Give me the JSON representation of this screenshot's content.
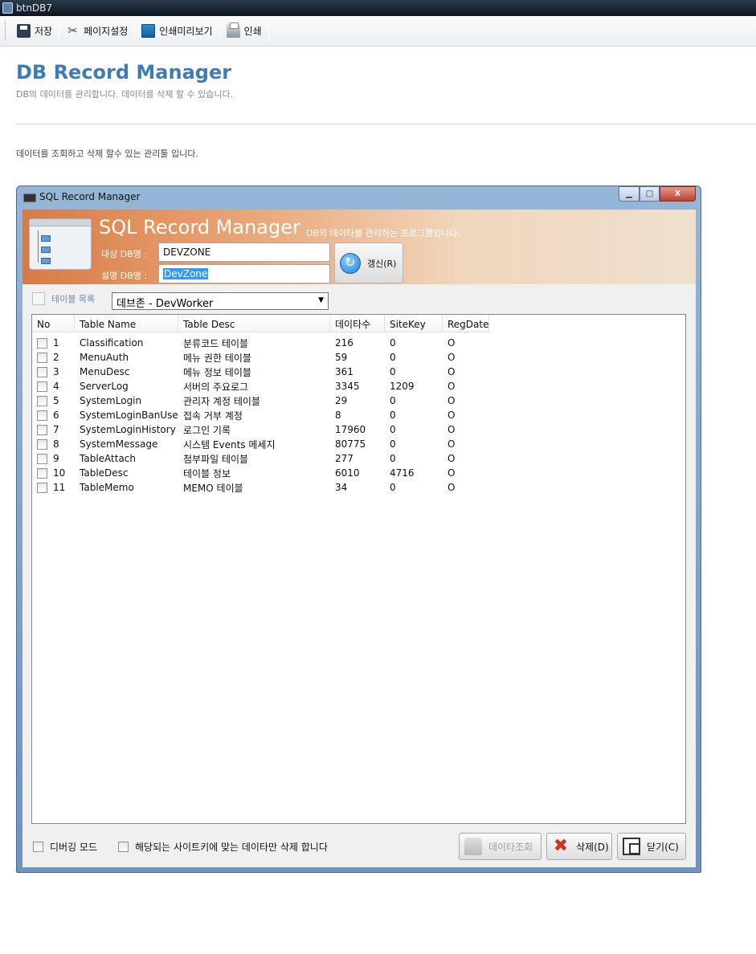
{
  "app_title": "btnDB7",
  "toolbar": {
    "save": "저장",
    "page_setup": "페이지설정",
    "print_preview": "인쇄미리보기",
    "print": "인쇄"
  },
  "page": {
    "title": "DB Record Manager",
    "subtitle": "DB의 데이터를 관리합니다. 데이터를 삭제 할 수 있습니다.",
    "description": "데이터를 조회하고 삭제 할수 있는 관리툴 입니다."
  },
  "window": {
    "title": "SQL Record Manager",
    "controls": {
      "min": "▁",
      "max": "□",
      "close": "X"
    }
  },
  "banner": {
    "title": "SQL Record Manager",
    "subtitle": "DB의 데이타를 관리하는 프로그램입니다.",
    "target_db_label": "대상 DB명 :",
    "target_db_value": "DEVZONE",
    "desc_db_label": "설명 DB명 :",
    "desc_db_value": "DevZone",
    "refresh_button": "갱신(R)"
  },
  "table_selector": {
    "label": "테이블 목록",
    "selected": "데브존 - DevWorker"
  },
  "grid": {
    "columns": [
      "No",
      "Table Name",
      "Table Desc",
      "데이타수",
      "SiteKey",
      "RegDate"
    ],
    "rows": [
      {
        "no": "1",
        "name": "Classification",
        "desc": "분류코드 테이블",
        "count": "216",
        "sitekey": "0",
        "regdate": "O"
      },
      {
        "no": "2",
        "name": "MenuAuth",
        "desc": "메뉴 권한 테이블",
        "count": "59",
        "sitekey": "0",
        "regdate": "O"
      },
      {
        "no": "3",
        "name": "MenuDesc",
        "desc": "메뉴 정보 테이블",
        "count": "361",
        "sitekey": "0",
        "regdate": "O"
      },
      {
        "no": "4",
        "name": "ServerLog",
        "desc": "서버의 주요로그",
        "count": "3345",
        "sitekey": "1209",
        "regdate": "O"
      },
      {
        "no": "5",
        "name": "SystemLogin",
        "desc": "관리자 계정 테이블",
        "count": "29",
        "sitekey": "0",
        "regdate": "O"
      },
      {
        "no": "6",
        "name": "SystemLoginBanUser",
        "desc": "접속 거부 계정",
        "count": "8",
        "sitekey": "0",
        "regdate": "O"
      },
      {
        "no": "7",
        "name": "SystemLoginHistory",
        "desc": "로그인 기록",
        "count": "17960",
        "sitekey": "0",
        "regdate": "O"
      },
      {
        "no": "8",
        "name": "SystemMessage",
        "desc": "시스템 Events 메세지",
        "count": "80775",
        "sitekey": "0",
        "regdate": "O"
      },
      {
        "no": "9",
        "name": "TableAttach",
        "desc": "첨부파일 테이블",
        "count": "277",
        "sitekey": "0",
        "regdate": "O"
      },
      {
        "no": "10",
        "name": "TableDesc",
        "desc": "테이블 정보",
        "count": "6010",
        "sitekey": "4716",
        "regdate": "O"
      },
      {
        "no": "11",
        "name": "TableMemo",
        "desc": "MEMO 테이블",
        "count": "34",
        "sitekey": "0",
        "regdate": "O"
      }
    ]
  },
  "footer": {
    "debug_mode": "디버깅 모드",
    "sitekey_only": "해당되는 사이트키에 맞는 데이타만 삭제 합니다",
    "query_button": "데이타조회",
    "delete_button": "삭제(D)",
    "close_button": "닫기(C)"
  }
}
